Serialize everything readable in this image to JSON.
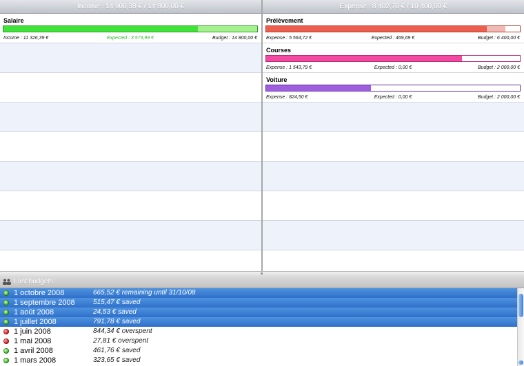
{
  "income": {
    "header": "Income : 14 900,38 € / 14 800,00 €",
    "categories": [
      {
        "name": "Salaire",
        "left": "Income : 11 326,39 €",
        "middle": "Expected : 3 573,99 €",
        "right": "Budget : 14 800,00 €",
        "fill_fraction": 0.765,
        "extra_fraction": 0.235,
        "colors": {
          "fill": "#3fe33a",
          "extra": "#a4f28e",
          "border": "#2c9a22"
        }
      }
    ]
  },
  "expense": {
    "header": "Expense : 8 402,70 € / 10 400,00 €",
    "categories": [
      {
        "name": "Prélèvement",
        "left": "Expense : 5 564,72 €",
        "middle": "Expected : 469,69 €",
        "right": "Budget : 6 400,00 €",
        "fill_fraction": 0.87,
        "extra_fraction": 0.073,
        "colors": {
          "fill": "#ec5f4f",
          "extra": "#f0b9b3",
          "border": "#b53a2c"
        }
      },
      {
        "name": "Courses",
        "left": "Expense : 1 543,79 €",
        "middle": "Expected : 0,00 €",
        "right": "Budget : 2 000,00 €",
        "fill_fraction": 0.772,
        "extra_fraction": 0,
        "colors": {
          "fill": "#f24aa2",
          "extra": "#f0b9d8",
          "border": "#b82a74"
        }
      },
      {
        "name": "Voiture",
        "left": "Expense : 824,50 €",
        "middle": "Expected : 0,00 €",
        "right": "Budget : 2 000,00 €",
        "fill_fraction": 0.412,
        "extra_fraction": 0,
        "colors": {
          "fill": "#9f5ee0",
          "extra": "#e2d0f3",
          "border": "#5e2f98"
        }
      }
    ]
  },
  "bottom": {
    "title": "Last budgets",
    "icon": "people-icon",
    "items": [
      {
        "date": "1 octobre 2008",
        "status": "665,52 € remaining until 31/10/08",
        "indicator": "green",
        "selected": true
      },
      {
        "date": "1 septembre 2008",
        "status": "515,47 € saved",
        "indicator": "green",
        "selected": true
      },
      {
        "date": "1 août 2008",
        "status": "24,53 € saved",
        "indicator": "green",
        "selected": true
      },
      {
        "date": "1 juillet 2008",
        "status": "791,78 € saved",
        "indicator": "green",
        "selected": true
      },
      {
        "date": "1 juin 2008",
        "status": "844,34 € overspent",
        "indicator": "red",
        "selected": false
      },
      {
        "date": "1 mai 2008",
        "status": "27,81 € overspent",
        "indicator": "red",
        "selected": false
      },
      {
        "date": "1 avril 2008",
        "status": "461,76 € saved",
        "indicator": "green",
        "selected": false
      },
      {
        "date": "1 mars 2008",
        "status": "323,65 € saved",
        "indicator": "green",
        "selected": false
      }
    ]
  },
  "colors": {
    "selection": "#3a7fd5",
    "row_alt": "#edf2fb"
  }
}
